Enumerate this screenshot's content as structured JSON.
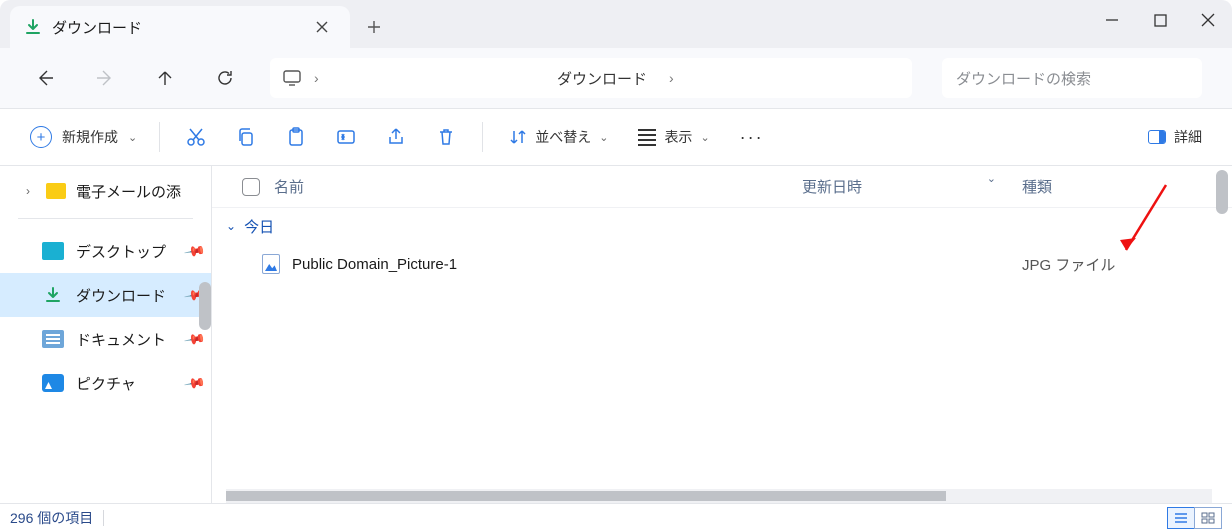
{
  "tab": {
    "title": "ダウンロード"
  },
  "breadcrumb": {
    "current": "ダウンロード"
  },
  "search": {
    "placeholder": "ダウンロードの検索"
  },
  "toolbar": {
    "new_label": "新規作成",
    "sort_label": "並べ替え",
    "view_label": "表示",
    "details_label": "詳細"
  },
  "sidebar": {
    "tree_item": "電子メールの添",
    "items": [
      {
        "label": "デスクトップ"
      },
      {
        "label": "ダウンロード"
      },
      {
        "label": "ドキュメント"
      },
      {
        "label": "ピクチャ"
      }
    ]
  },
  "columns": {
    "name": "名前",
    "date": "更新日時",
    "type": "種類"
  },
  "group": {
    "label": "今日"
  },
  "files": [
    {
      "name": "Public Domain_Picture-1",
      "date": "",
      "type": "JPG ファイル"
    }
  ],
  "status": {
    "count": "296 個の項目"
  }
}
